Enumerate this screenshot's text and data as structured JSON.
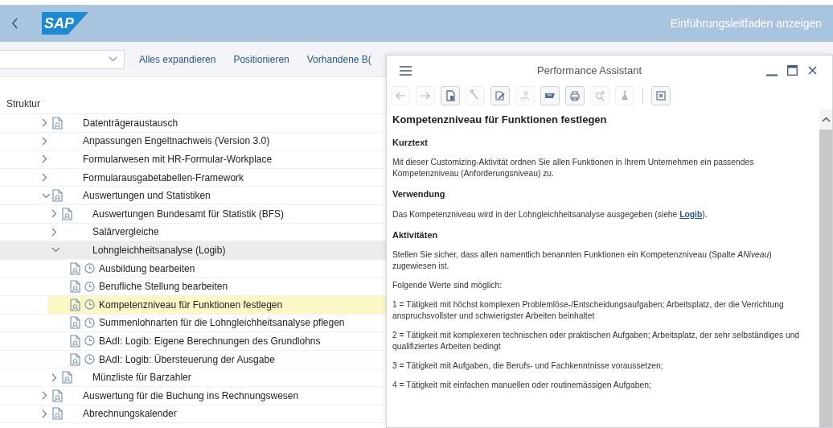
{
  "header": {
    "logo": "SAP",
    "title": "Einführungsleitfaden anzeigen"
  },
  "toolbar": {
    "buttons": [
      "Alles expandieren",
      "Positionieren",
      "Vorhandene B("
    ]
  },
  "tree": {
    "heading": "Struktur",
    "items": [
      {
        "label": "Datenträgeraustausch",
        "kind": "node",
        "doc": true,
        "expanded": false,
        "selected": false,
        "hovered": false
      },
      {
        "label": "Anpassungen Engeltnachweis (Version 3.0)",
        "kind": "node",
        "doc": false,
        "expanded": false,
        "selected": false,
        "hovered": false
      },
      {
        "label": "Formularwesen mit HR-Formular-Workplace",
        "kind": "node",
        "doc": false,
        "expanded": false,
        "selected": false,
        "hovered": false
      },
      {
        "label": "Formularausgabetabellen-Framework",
        "kind": "node",
        "doc": false,
        "expanded": false,
        "selected": false,
        "hovered": false
      },
      {
        "label": "Auswertungen und Statistiken",
        "kind": "node",
        "doc": true,
        "expanded": true,
        "selected": false,
        "hovered": false,
        "children": [
          {
            "label": "Auswertungen Bundesamt für Statistik (BFS)",
            "kind": "node",
            "doc": true,
            "expanded": false,
            "selected": false,
            "hovered": false
          },
          {
            "label": "Salärvergleiche",
            "kind": "node",
            "doc": false,
            "expanded": false,
            "selected": false,
            "hovered": false
          },
          {
            "label": "Lohngleichheitsanalyse (Logib)",
            "kind": "node",
            "doc": false,
            "expanded": true,
            "selected": false,
            "hovered": true,
            "children": [
              {
                "label": "Ausbildung bearbeiten",
                "kind": "activity",
                "selected": false,
                "hovered": false
              },
              {
                "label": "Berufliche Stellung bearbeiten",
                "kind": "activity",
                "selected": false,
                "hovered": false
              },
              {
                "label": "Kompetenzniveau für Funktionen festlegen",
                "kind": "activity",
                "selected": true,
                "hovered": false
              },
              {
                "label": "Summenlohnarten für die Lohngleichheitsanalyse pflegen",
                "kind": "activity",
                "selected": false,
                "hovered": false
              },
              {
                "label": "BAdI: Logib: Eigene Berechnungen des Grundlohns",
                "kind": "activity",
                "selected": false,
                "hovered": false
              },
              {
                "label": "BAdI: Logib: Übersteuerung der Ausgabe",
                "kind": "activity",
                "selected": false,
                "hovered": false
              }
            ]
          },
          {
            "label": "Münzliste für Barzahler",
            "kind": "node",
            "doc": true,
            "expanded": false,
            "selected": false,
            "hovered": false
          }
        ]
      },
      {
        "label": "Auswertung für die Buchung ins Rechnungswesen",
        "kind": "node",
        "doc": true,
        "expanded": false,
        "selected": false,
        "hovered": false
      },
      {
        "label": "Abrechnungskalender",
        "kind": "node",
        "doc": true,
        "expanded": false,
        "selected": false,
        "hovered": false
      }
    ]
  },
  "assistant": {
    "title": "Performance Assistant",
    "tools": [
      {
        "disabled": true
      },
      {
        "disabled": true
      },
      {
        "disabled": false
      },
      {
        "disabled": true
      },
      {
        "disabled": false
      },
      {
        "disabled": true
      },
      {
        "disabled": false
      },
      {
        "disabled": false
      },
      {
        "disabled": true
      },
      {
        "disabled": true
      },
      {
        "disabled": false
      }
    ],
    "content": [
      {
        "kind": "heading",
        "text": "Kompetenzniveau für Funktionen festlegen"
      },
      {
        "kind": "subheading",
        "text": "Kurztext"
      },
      {
        "kind": "paragraph",
        "text": "Mit dieser Customizing-Aktivität ordnen Sie allen Funktionen in Ihrem Unternehmen ein passendes Kompetenzniveau (Anforderungsniveau) zu."
      },
      {
        "kind": "subheading",
        "text": "Verwendung"
      },
      {
        "kind": "paragraph",
        "text": "Das Kompetenzniveau wird in der Lohngleichheitsanalyse ausgegeben (siehe ",
        "link": "Logib",
        "text_after": ")."
      },
      {
        "kind": "subheading",
        "text": "Aktivitäten"
      },
      {
        "kind": "paragraph",
        "text": "Stellen Sie sicher, dass allen namentlich benannten Funktionen ein Kompetenzniveau (Spalte *ANiveau*) zugewiesen ist."
      },
      {
        "kind": "paragraph",
        "text": "Folgende Werte sind möglich:"
      },
      {
        "kind": "paragraph",
        "text": "1 = Tätigkeit mit höchst komplexen Problemlöse-/Entscheidungsaufgaben; Arbeitsplatz, der die Verrichtung anspruchsvollster und schwierigster Arbeiten beinhaltet"
      },
      {
        "kind": "paragraph",
        "text": "2 = Tätigkeit mit komplexeren technischen oder praktischen Aufgaben; Arbeitsplatz, der sehr selbständiges und qualifiziertes Arbeiten bedingt"
      },
      {
        "kind": "paragraph",
        "text": "3 = Tätigkeit mit Aufgaben, die Berufs- und Fachkenntnisse voraussetzen;"
      },
      {
        "kind": "paragraph",
        "text": "4 = Tätigkeit mit einfachen manuellen oder routinemässigen Aufgaben;"
      }
    ]
  }
}
